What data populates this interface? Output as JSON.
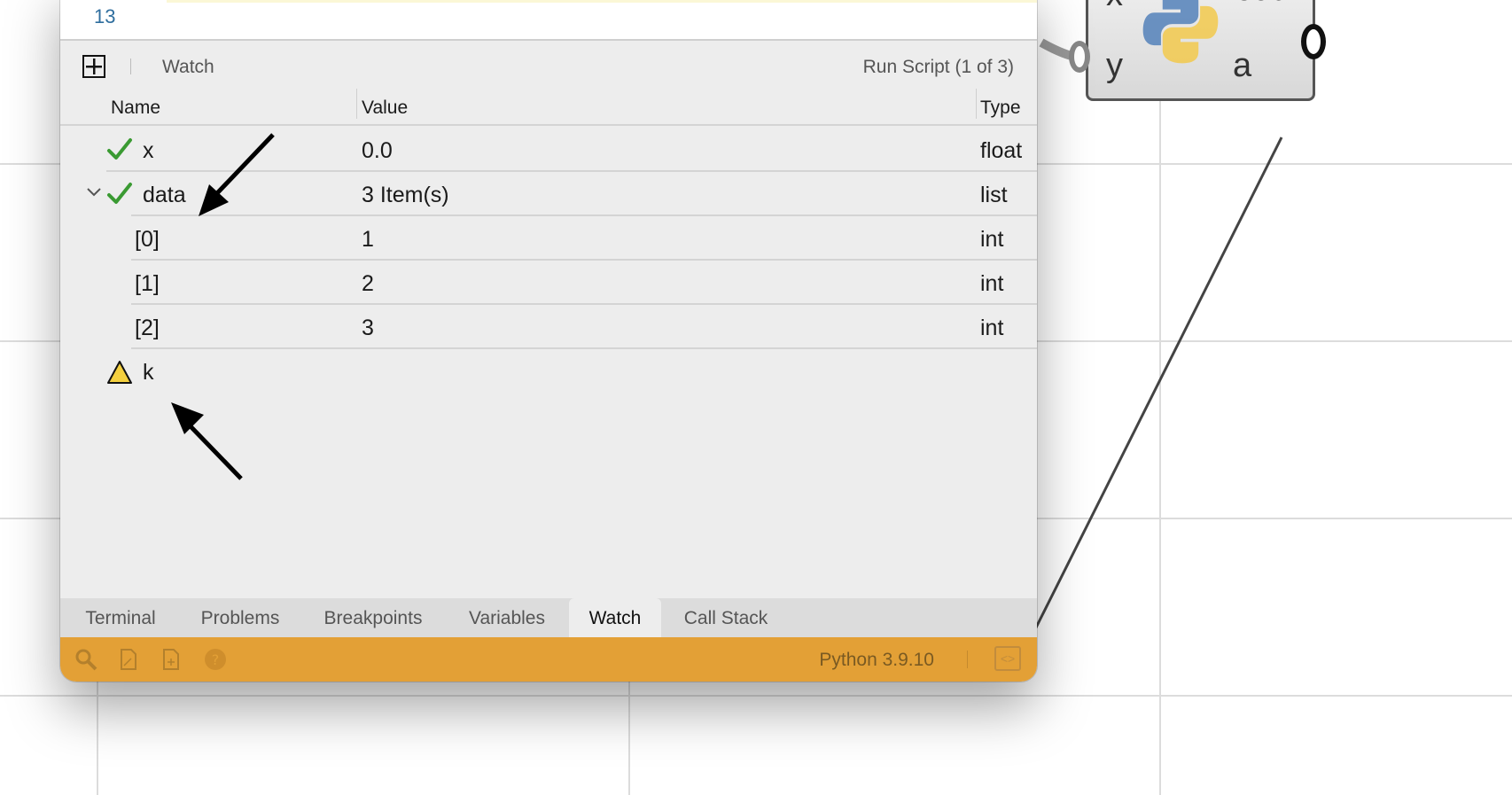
{
  "editor": {
    "line_number": "13"
  },
  "watch_panel": {
    "title": "Watch",
    "run_label": "Run Script (1 of 3)",
    "columns": {
      "name": "Name",
      "value": "Value",
      "type": "Type"
    },
    "rows": [
      {
        "name": "x",
        "value": "0.0",
        "type": "float",
        "status": "check-icon"
      },
      {
        "name": "data",
        "value": "3 Item(s)",
        "type": "list",
        "status": "check-icon",
        "expanded": true
      },
      {
        "name": "[0]",
        "value": "1",
        "type": "int"
      },
      {
        "name": "[1]",
        "value": "2",
        "type": "int"
      },
      {
        "name": "[2]",
        "value": "3",
        "type": "int"
      },
      {
        "name": "k",
        "value": "",
        "type": "",
        "status": "warning-icon"
      }
    ]
  },
  "tabs": [
    "Terminal",
    "Problems",
    "Breakpoints",
    "Variables",
    "Watch",
    "Call Stack"
  ],
  "active_tab": "Watch",
  "status_bar": {
    "version": "Python 3.9.10",
    "icons": [
      "search-icon",
      "file-icon",
      "file-plus-icon",
      "help-icon"
    ],
    "color": "#e3a036"
  },
  "component": {
    "input_x": "x",
    "input_y": "y",
    "output_out": "out",
    "output_a": "a"
  },
  "colors": {
    "check": "#3a9a32",
    "warning": "#f4d03f",
    "line_number": "#2f6e9e"
  }
}
